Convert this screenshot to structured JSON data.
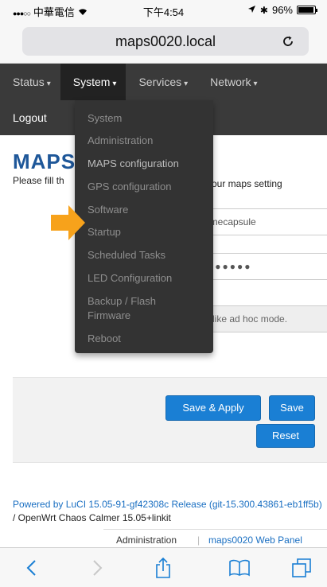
{
  "status_bar": {
    "signal": "●●●○○",
    "carrier": "中華電信",
    "time": "下午4:54",
    "battery": "96%",
    "battery_level": 0.96
  },
  "address_bar": {
    "url": "maps0020.local"
  },
  "nav": {
    "items": [
      {
        "label": "Status"
      },
      {
        "label": "System"
      },
      {
        "label": "Services"
      },
      {
        "label": "Network"
      }
    ],
    "logout": "Logout"
  },
  "dropdown": {
    "items": [
      {
        "label": "System"
      },
      {
        "label": "Administration"
      },
      {
        "label": "MAPS configuration"
      },
      {
        "label": "GPS configuration"
      },
      {
        "label": "Software"
      },
      {
        "label": "Startup"
      },
      {
        "label": "Scheduled Tasks"
      },
      {
        "label": "LED Configuration"
      },
      {
        "label": "Backup / Flash"
      },
      {
        "label": "Firmware"
      },
      {
        "label": "Reboot"
      }
    ]
  },
  "content": {
    "title": "MAPS",
    "desc_start": "Please fill th",
    "desc_end": "our maps setting",
    "field1_value": "imecapsule",
    "field2_value": "●●●●●●",
    "field3_value": "l like ad hoc mode."
  },
  "buttons": {
    "save_apply": "Save & Apply",
    "save": "Save",
    "reset": "Reset"
  },
  "footer": {
    "luci_link": "Powered by LuCI 15.05-91-gf42308c Release (git-15.300.43861-eb1ff5b)",
    "version_text": " / OpenWrt Chaos Calmer 15.05+linkit",
    "crumb_admin": "Administration",
    "separator": "|",
    "crumb_panel": "maps0020 Web Panel"
  },
  "colors": {
    "accent": "#1a7fd4",
    "arrow": "#f7a21b",
    "navbar": "#3a3a3a",
    "title": "#1e5799"
  },
  "toolbar_icons": [
    "back-icon",
    "forward-icon",
    "share-icon",
    "bookmarks-icon",
    "tabs-icon"
  ]
}
